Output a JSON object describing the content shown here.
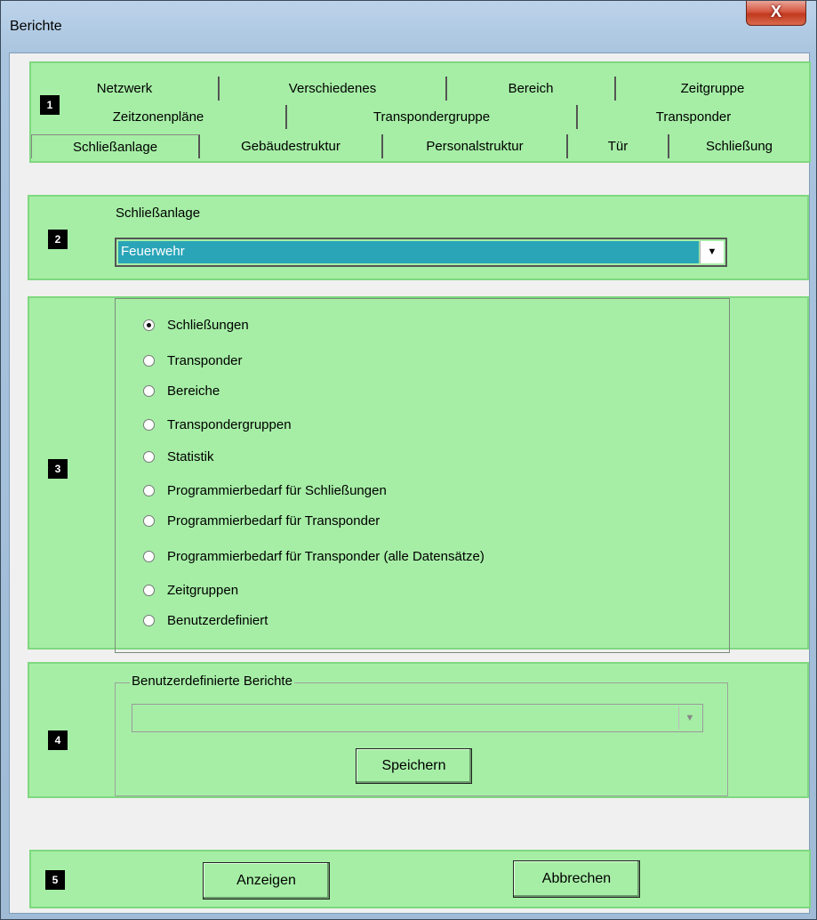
{
  "window": {
    "title": "Berichte",
    "close_glyph": "X"
  },
  "markers": [
    "1",
    "2",
    "3",
    "4",
    "5"
  ],
  "tabs": {
    "row1": [
      "Netzwerk",
      "Verschiedenes",
      "Bereich",
      "Zeitgruppe"
    ],
    "row2": [
      "Zeitzonenpläne",
      "Transpondergruppe",
      "Transponder"
    ],
    "row3": [
      "Schließanlage",
      "Gebäudestruktur",
      "Personalstruktur",
      "Tür",
      "Schließung"
    ],
    "selected": "Schließanlage"
  },
  "system": {
    "label": "Schließanlage",
    "selected": "Feuerwehr"
  },
  "report_types": {
    "selected": "Schließungen",
    "options": [
      "Schließungen",
      "Transponder",
      "Bereiche",
      "Transpondergruppen",
      "Statistik",
      "Programmierbedarf für Schließungen",
      "Programmierbedarf für Transponder",
      "Programmierbedarf für Transponder (alle Datensätze)",
      "Zeitgruppen",
      "Benutzerdefiniert"
    ]
  },
  "custom_reports": {
    "legend": "Benutzerdefinierte Berichte",
    "value": "",
    "save_label": "Speichern"
  },
  "footer": {
    "show_label": "Anzeigen",
    "cancel_label": "Abbrechen"
  }
}
